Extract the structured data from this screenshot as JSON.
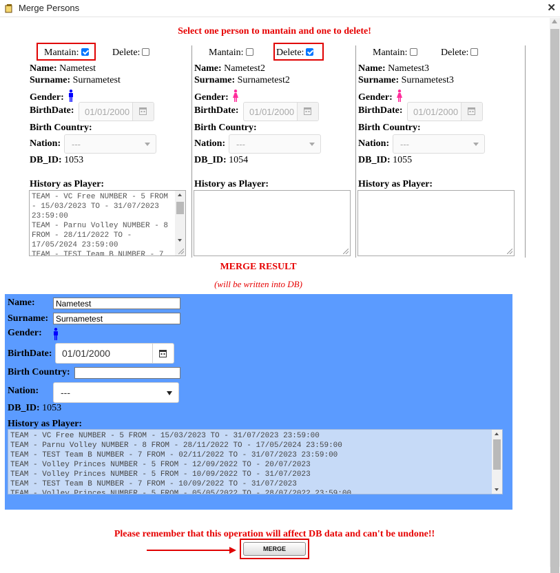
{
  "window": {
    "title": "Merge Persons",
    "close_glyph": "✕"
  },
  "instruction": "Select one person to mantain and one to delete!",
  "labels": {
    "mantain": "Mantain:",
    "delete": "Delete:",
    "name": "Name:",
    "surname": "Surname:",
    "gender": "Gender:",
    "birthdate": "BirthDate:",
    "birth_country": "Birth Country:",
    "nation": "Nation:",
    "db_id": "DB_ID:",
    "history": "History as Player:"
  },
  "persons": [
    {
      "mantain": true,
      "delete": false,
      "name": "Nametest",
      "surname": "Surnametest",
      "gender": "male",
      "birthdate": "01/01/2000",
      "birth_country": "",
      "nation": "---",
      "db_id": "1053",
      "history": "TEAM - VC Free NUMBER - 5 FROM - 15/03/2023 TO - 31/07/2023 23:59:00\nTEAM - Parnu Volley NUMBER - 8 FROM - 28/11/2022 TO - 17/05/2024 23:59:00\nTEAM - TEST Team B NUMBER - 7"
    },
    {
      "mantain": false,
      "delete": true,
      "name": "Nametest2",
      "surname": "Surnametest2",
      "gender": "female",
      "birthdate": "01/01/2000",
      "birth_country": "",
      "nation": "---",
      "db_id": "1054",
      "history": ""
    },
    {
      "mantain": false,
      "delete": false,
      "name": "Nametest3",
      "surname": "Surnametest3",
      "gender": "female",
      "birthdate": "01/01/2000",
      "birth_country": "",
      "nation": "---",
      "db_id": "1055",
      "history": ""
    }
  ],
  "merge": {
    "title": "MERGE RESULT",
    "subtitle": "(will be written into DB)",
    "name": "Nametest",
    "surname": "Surnametest",
    "gender": "male",
    "birthdate": "01/01/2000",
    "birth_country": "",
    "nation": "---",
    "db_id": "1053",
    "history": "TEAM - VC Free NUMBER - 5 FROM - 15/03/2023 TO - 31/07/2023 23:59:00\nTEAM - Parnu Volley NUMBER - 8 FROM - 28/11/2022 TO - 17/05/2024 23:59:00\nTEAM - TEST Team B NUMBER - 7 FROM - 02/11/2022 TO - 31/07/2023 23:59:00\nTEAM - Volley Princes NUMBER - 5 FROM - 12/09/2022 TO - 20/07/2023\nTEAM - Volley Princes NUMBER - 5 FROM - 10/09/2022 TO - 31/07/2023\nTEAM - TEST Team B NUMBER - 7 FROM - 10/09/2022 TO - 31/07/2023\nTEAM - Volley Princes NUMBER - 5 FROM - 05/05/2022 TO - 28/07/2022 23:59:00"
  },
  "warning": "Please remember that this operation will affect DB data and can't be undone!!",
  "merge_button": "MERGE",
  "colors": {
    "accent_red": "#e60000",
    "panel_blue": "#5b9bff",
    "checkbox_blue": "#0075ff",
    "male_icon": "#0000ff",
    "female_icon": "#ff2d9b"
  },
  "icons": {
    "male": "male-person-icon",
    "female": "female-person-icon",
    "calendar": "calendar-icon",
    "dropdown": "chevron-down-icon"
  }
}
